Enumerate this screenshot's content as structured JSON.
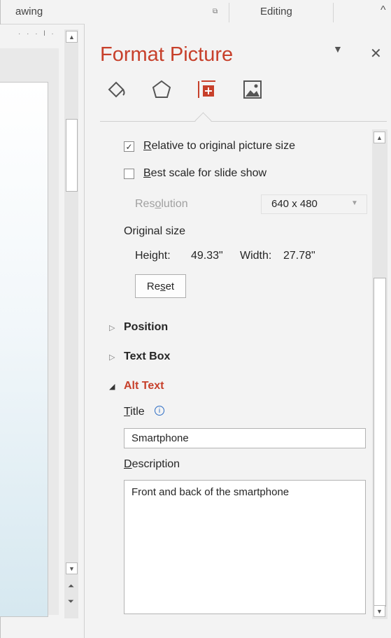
{
  "ribbon": {
    "group_left": "awing",
    "group_editing": "Editing"
  },
  "pane": {
    "title": "Format Picture",
    "tabs": [
      {
        "name": "fill-line-icon"
      },
      {
        "name": "effects-icon"
      },
      {
        "name": "size-properties-icon"
      },
      {
        "name": "picture-icon"
      }
    ],
    "relative_label_pre": "",
    "relative_label_key": "R",
    "relative_label_post": "elative to original picture size",
    "relative_checked": true,
    "best_scale_key": "B",
    "best_scale_post": "est scale for slide show",
    "best_scale_checked": false,
    "resolution_pre": "Res",
    "resolution_key": "o",
    "resolution_post": "lution",
    "resolution_value": "640 x 480",
    "original_size_label": "Original size",
    "height_label": "Height:",
    "height_value": "49.33\"",
    "width_label": "Width:",
    "width_value": "27.78\"",
    "reset_pre": "Re",
    "reset_key": "s",
    "reset_post": "et",
    "sections": {
      "position": "Position",
      "text_box": "Text Box",
      "alt_text": "Alt Text"
    },
    "title_key": "T",
    "title_post": "itle",
    "title_value": "Smartphone",
    "description_key": "D",
    "description_post": "escription",
    "description_value": "Front and back of the smartphone"
  },
  "colors": {
    "accent": "#c7402b",
    "pane_bg": "#f3f3f3",
    "info": "#2b6cc4"
  }
}
